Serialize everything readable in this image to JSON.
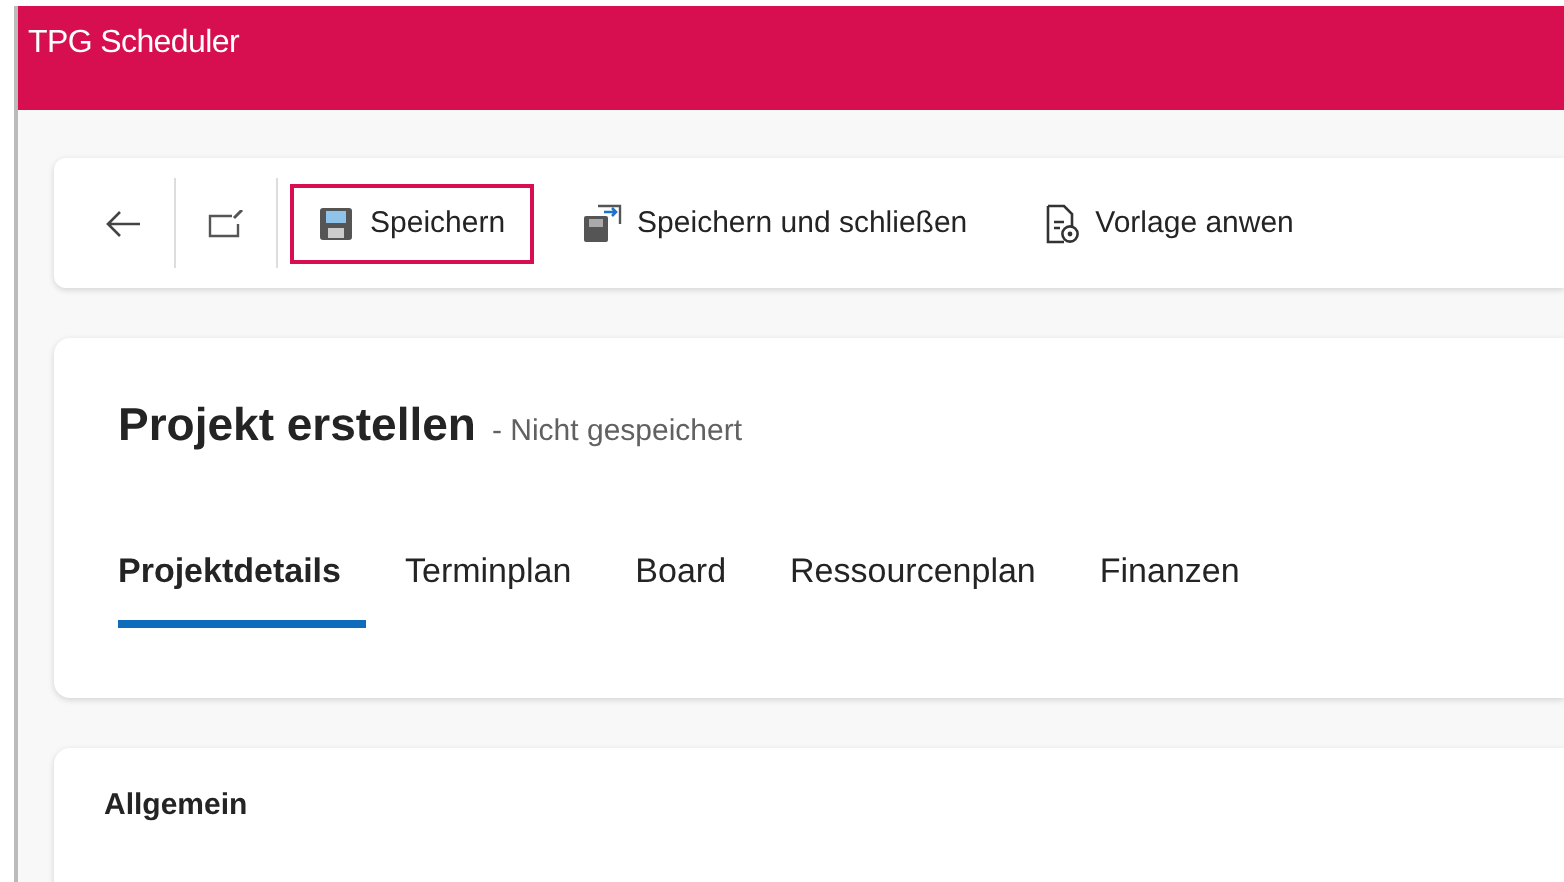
{
  "window": {
    "title": "TPG Scheduler"
  },
  "toolbar": {
    "items": [
      {
        "kind": "back",
        "highlighted": false
      },
      {
        "kind": "popout",
        "highlighted": false
      },
      {
        "kind": "save",
        "label": "Speichern",
        "highlighted": true
      },
      {
        "kind": "save-close",
        "label": "Speichern und schließen",
        "highlighted": false
      },
      {
        "kind": "template",
        "label": "Vorlage anwen",
        "highlighted": false
      }
    ]
  },
  "header": {
    "title": "Projekt erstellen",
    "status": "- Nicht gespeichert"
  },
  "tabs": [
    {
      "label": "Projektdetails",
      "selected": true
    },
    {
      "label": "Terminplan",
      "selected": false
    },
    {
      "label": "Board",
      "selected": false
    },
    {
      "label": "Ressourcenplan",
      "selected": false
    },
    {
      "label": "Finanzen",
      "selected": false
    }
  ],
  "section": {
    "title": "Allgemein"
  }
}
